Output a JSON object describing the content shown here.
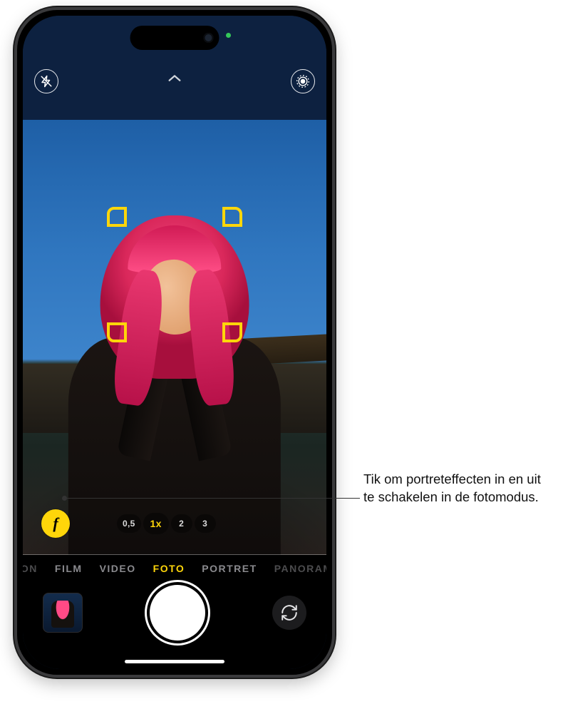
{
  "topbar": {
    "flash_name": "flash-icon",
    "chevron_name": "chevron-up-icon",
    "live_name": "live-photo-icon"
  },
  "depth_button": {
    "label": "f"
  },
  "zoom": [
    {
      "label": "0,5",
      "active": false
    },
    {
      "label": "1x",
      "active": true
    },
    {
      "label": "2",
      "active": false
    },
    {
      "label": "3",
      "active": false
    }
  ],
  "modes": [
    {
      "label": "ION",
      "active": false,
      "edge": true
    },
    {
      "label": "FILM",
      "active": false,
      "edge": false
    },
    {
      "label": "VIDEO",
      "active": false,
      "edge": false
    },
    {
      "label": "FOTO",
      "active": true,
      "edge": false
    },
    {
      "label": "PORTRET",
      "active": false,
      "edge": false
    },
    {
      "label": "PANORAM",
      "active": false,
      "edge": true
    }
  ],
  "controls": {
    "last_photo_name": "last-photo-thumbnail",
    "shutter_name": "shutter-button",
    "switch_name": "switch-camera-button"
  },
  "callout": {
    "text": "Tik om portreteffecten in en uit te schakelen in de fotomodus."
  },
  "focus": {
    "color": "#ffd60a"
  }
}
